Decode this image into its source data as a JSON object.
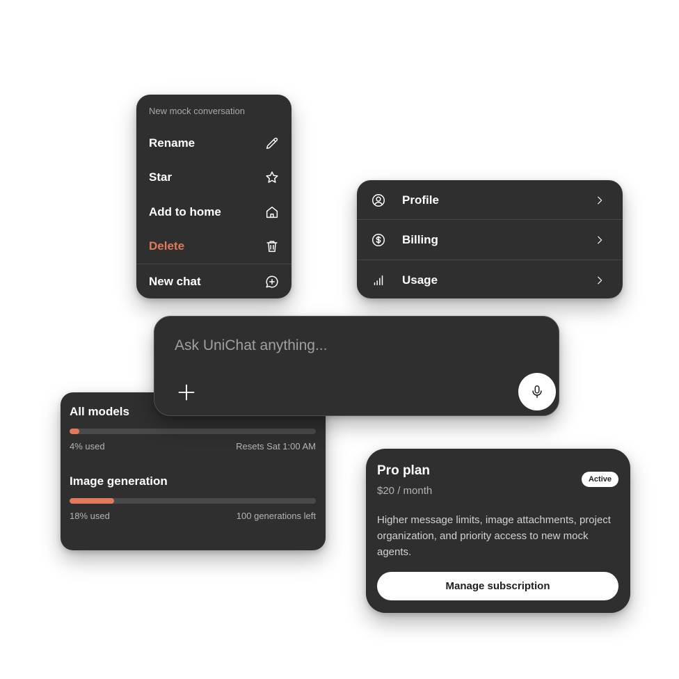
{
  "context_menu": {
    "title": "New mock conversation",
    "items": [
      {
        "label": "Rename",
        "icon": "pencil-icon"
      },
      {
        "label": "Star",
        "icon": "star-icon"
      },
      {
        "label": "Add to home",
        "icon": "home-icon"
      },
      {
        "label": "Delete",
        "icon": "trash-icon",
        "color": "#e07a5f"
      },
      {
        "label": "New chat",
        "icon": "chat-plus-icon"
      }
    ]
  },
  "account_menu": {
    "items": [
      {
        "label": "Profile",
        "icon": "user-circle-icon"
      },
      {
        "label": "Billing",
        "icon": "dollar-circle-icon"
      },
      {
        "label": "Usage",
        "icon": "bar-chart-icon"
      }
    ]
  },
  "composer": {
    "placeholder": "Ask UniChat anything...",
    "add_icon": "plus-icon",
    "mic_icon": "microphone-icon"
  },
  "usage": {
    "sections": [
      {
        "title": "All models",
        "percent_used": 4,
        "used_label": "4% used",
        "right_label": "Resets Sat 1:00 AM"
      },
      {
        "title": "Image generation",
        "percent_used": 18,
        "used_label": "18% used",
        "right_label": "100 generations left"
      }
    ],
    "bar_color": "#e07a5f"
  },
  "plan": {
    "title": "Pro plan",
    "price": "$20 / month",
    "badge": "Active",
    "description": "Higher message limits, image attachments, project organization, and priority access to new mock agents.",
    "button": "Manage subscription"
  },
  "colors": {
    "card_bg": "#2f2f2f",
    "accent": "#e07a5f"
  }
}
